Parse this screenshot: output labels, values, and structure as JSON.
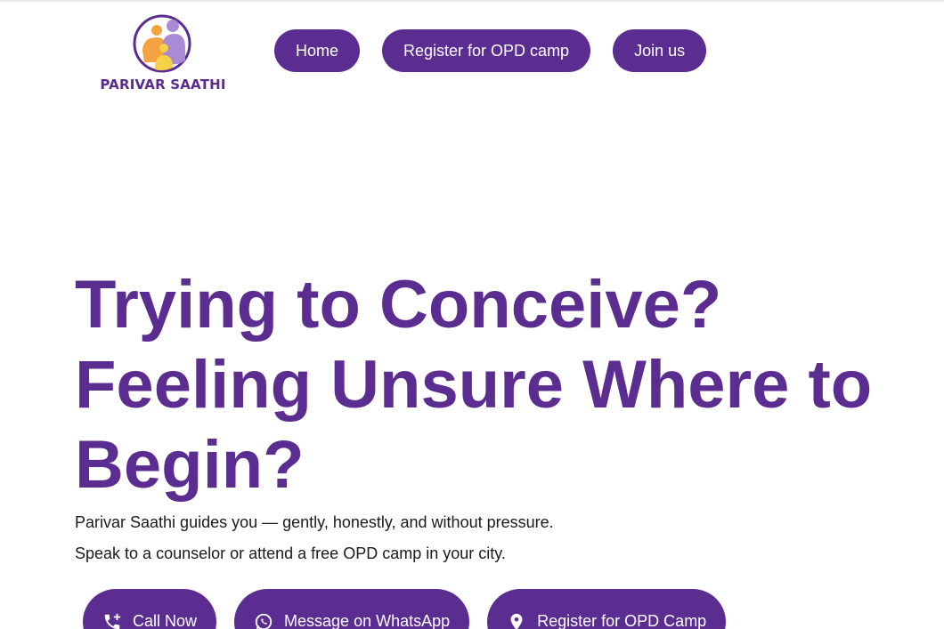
{
  "brand": {
    "name": "PARIVAR SAATHI",
    "logo_icon": "family-circle-logo",
    "colors": {
      "primary": "#5c2d91",
      "orange": "#f4a340",
      "yellow": "#f7d04a",
      "lavender": "#a98ad6"
    }
  },
  "nav": {
    "items": [
      {
        "label": "Home"
      },
      {
        "label": "Register for OPD camp"
      },
      {
        "label": "Join us"
      }
    ]
  },
  "hero": {
    "title_lines": [
      "Trying to Conceive?",
      "Feeling Unsure Where to",
      "Begin?"
    ],
    "subtitle_1": "Parivar Saathi guides you — gently, honestly, and without pressure.",
    "subtitle_2": "Speak to a counselor or attend a free OPD camp in your city."
  },
  "cta": {
    "call": {
      "label": "Call Now",
      "icon": "phone-plus-icon"
    },
    "whatsapp": {
      "label": "Message on WhatsApp",
      "icon": "whatsapp-icon"
    },
    "register": {
      "label": "Register for OPD Camp",
      "icon": "location-pin-icon"
    }
  }
}
